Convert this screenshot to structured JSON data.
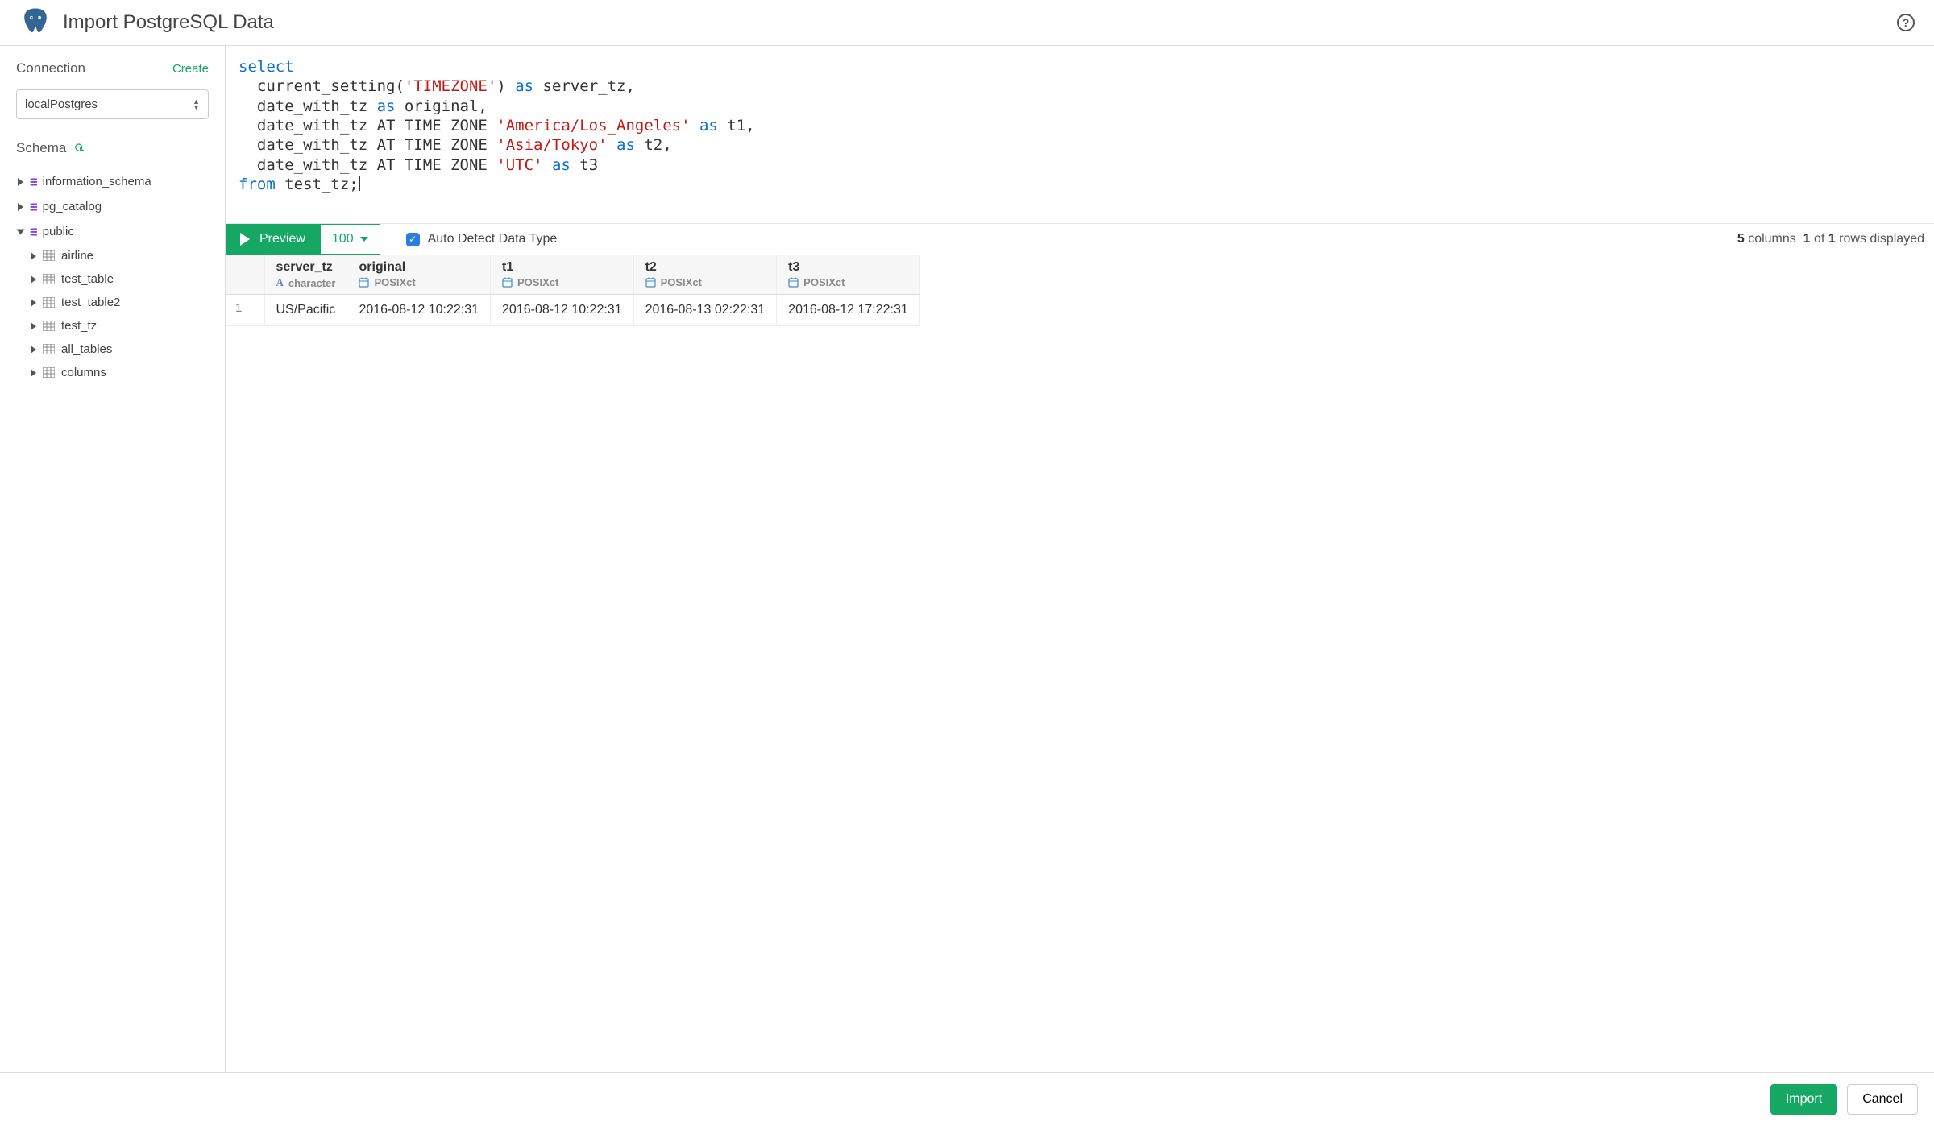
{
  "header": {
    "title": "Import PostgreSQL Data"
  },
  "sidebar": {
    "connection_label": "Connection",
    "create_label": "Create",
    "connection_selected": "localPostgres",
    "schema_label": "Schema",
    "tree": {
      "schemas": [
        {
          "name": "information_schema",
          "expanded": false
        },
        {
          "name": "pg_catalog",
          "expanded": false
        },
        {
          "name": "public",
          "expanded": true,
          "tables": [
            {
              "name": "airline"
            },
            {
              "name": "test_table"
            },
            {
              "name": "test_table2"
            },
            {
              "name": "test_tz"
            },
            {
              "name": "all_tables"
            },
            {
              "name": "columns"
            }
          ]
        }
      ]
    }
  },
  "editor": {
    "tokens": [
      [
        "kw",
        "select"
      ],
      [
        "nl",
        ""
      ],
      [
        "pl",
        "  current_setting("
      ],
      [
        "str",
        "'TIMEZONE'"
      ],
      [
        "pl",
        ") "
      ],
      [
        "kw",
        "as"
      ],
      [
        "pl",
        " server_tz,"
      ],
      [
        "nl",
        ""
      ],
      [
        "pl",
        "  date_with_tz "
      ],
      [
        "kw",
        "as"
      ],
      [
        "pl",
        " original,"
      ],
      [
        "nl",
        ""
      ],
      [
        "pl",
        "  date_with_tz AT TIME ZONE "
      ],
      [
        "str",
        "'America/Los_Angeles'"
      ],
      [
        "pl",
        " "
      ],
      [
        "kw",
        "as"
      ],
      [
        "pl",
        " t1,"
      ],
      [
        "nl",
        ""
      ],
      [
        "pl",
        "  date_with_tz AT TIME ZONE "
      ],
      [
        "str",
        "'Asia/Tokyo'"
      ],
      [
        "pl",
        " "
      ],
      [
        "kw",
        "as"
      ],
      [
        "pl",
        " t2,"
      ],
      [
        "nl",
        ""
      ],
      [
        "pl",
        "  date_with_tz AT TIME ZONE "
      ],
      [
        "str",
        "'UTC'"
      ],
      [
        "pl",
        " "
      ],
      [
        "kw",
        "as"
      ],
      [
        "pl",
        " t3"
      ],
      [
        "nl",
        ""
      ],
      [
        "kw",
        "from"
      ],
      [
        "pl",
        " test_tz;"
      ]
    ]
  },
  "results_bar": {
    "preview_label": "Preview",
    "limit_label": "100",
    "autodetect_label": "Auto Detect Data Type",
    "autodetect_checked": true,
    "summary": {
      "columns": 5,
      "rows_shown": 1,
      "rows_total": 1,
      "text_columns": "columns",
      "text_of": "of",
      "text_rows_displayed": "rows displayed"
    }
  },
  "results": {
    "columns": [
      {
        "name": "server_tz",
        "type": "character",
        "type_kind": "text"
      },
      {
        "name": "original",
        "type": "POSIXct",
        "type_kind": "datetime"
      },
      {
        "name": "t1",
        "type": "POSIXct",
        "type_kind": "datetime"
      },
      {
        "name": "t2",
        "type": "POSIXct",
        "type_kind": "datetime"
      },
      {
        "name": "t3",
        "type": "POSIXct",
        "type_kind": "datetime"
      }
    ],
    "rows": [
      {
        "n": 1,
        "cells": [
          "US/Pacific",
          "2016-08-12 10:22:31",
          "2016-08-12 10:22:31",
          "2016-08-13 02:22:31",
          "2016-08-12 17:22:31"
        ]
      }
    ]
  },
  "footer": {
    "import_label": "Import",
    "cancel_label": "Cancel"
  }
}
